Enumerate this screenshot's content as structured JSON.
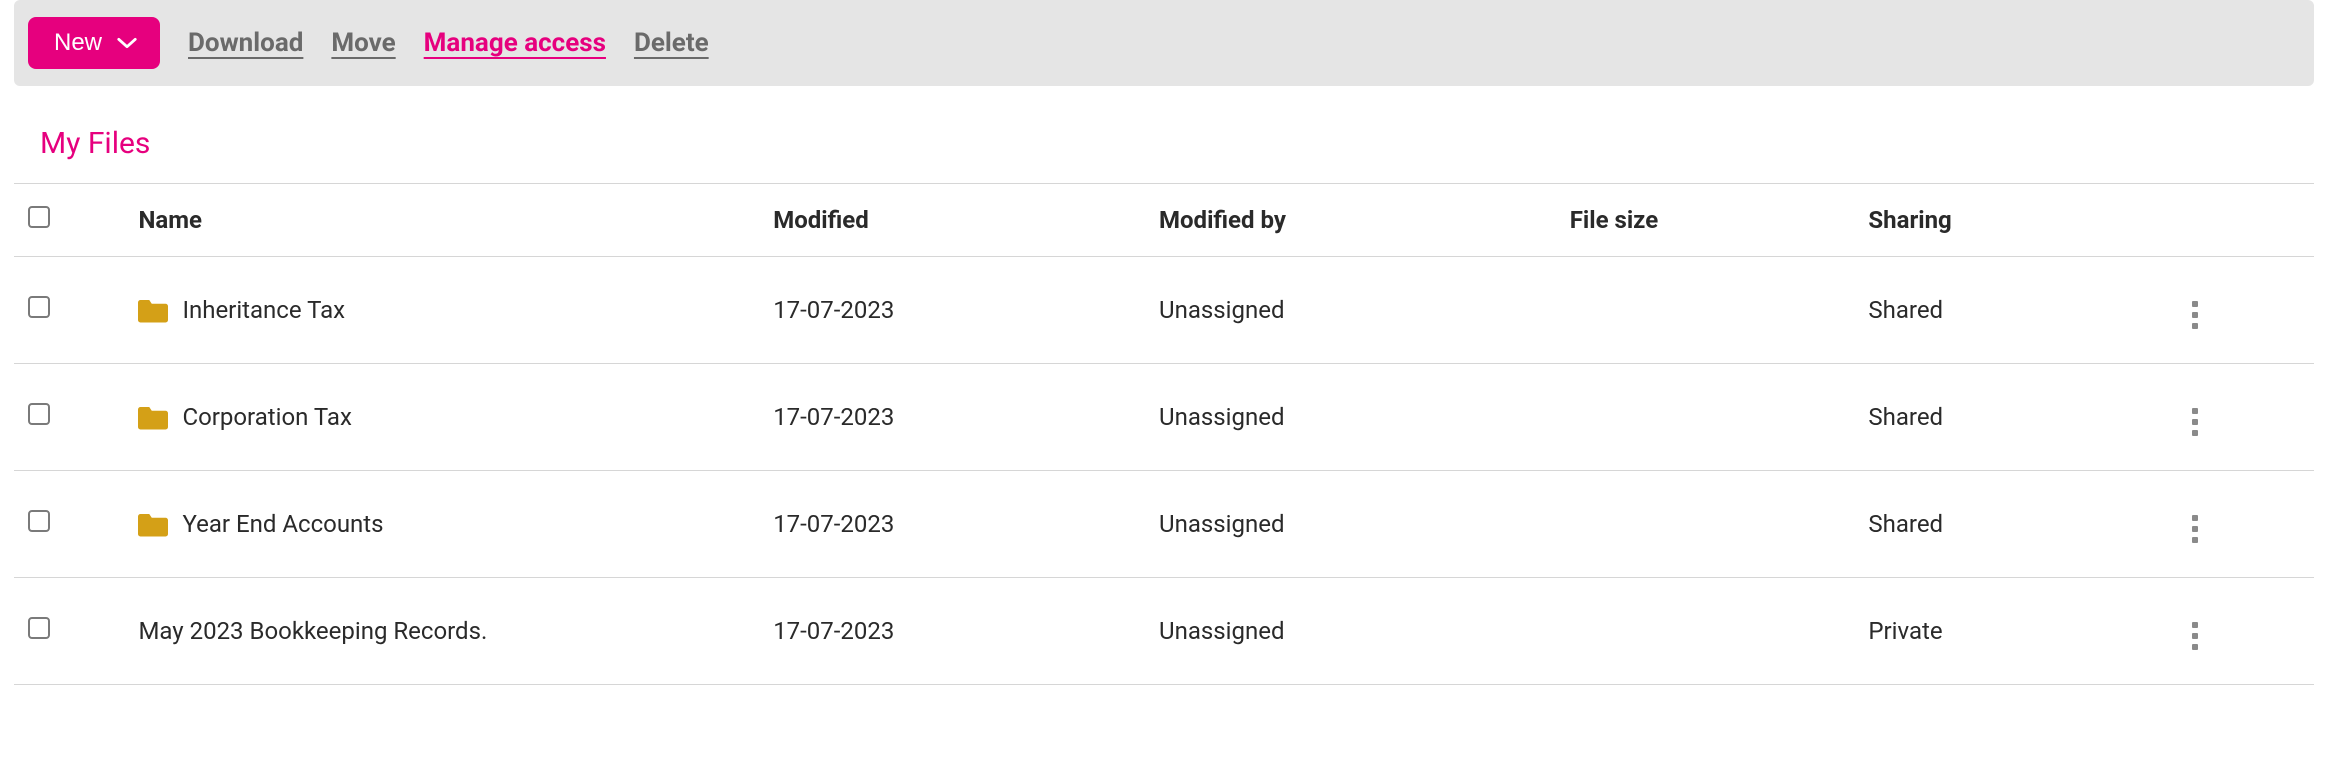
{
  "toolbar": {
    "new_label": "New",
    "download_label": "Download",
    "move_label": "Move",
    "manage_access_label": "Manage access",
    "delete_label": "Delete"
  },
  "page_title": "My Files",
  "columns": {
    "name": "Name",
    "modified": "Modified",
    "modified_by": "Modified by",
    "file_size": "File size",
    "sharing": "Sharing"
  },
  "rows": [
    {
      "name": "Inheritance Tax",
      "is_folder": true,
      "modified": "17-07-2023",
      "modified_by": "Unassigned",
      "file_size": "",
      "sharing": "Shared"
    },
    {
      "name": "Corporation Tax",
      "is_folder": true,
      "modified": "17-07-2023",
      "modified_by": "Unassigned",
      "file_size": "",
      "sharing": "Shared"
    },
    {
      "name": "Year End Accounts",
      "is_folder": true,
      "modified": "17-07-2023",
      "modified_by": "Unassigned",
      "file_size": "",
      "sharing": "Shared"
    },
    {
      "name": "May 2023 Bookkeeping Records.",
      "is_folder": false,
      "modified": "17-07-2023",
      "modified_by": "Unassigned",
      "file_size": "",
      "sharing": "Private"
    }
  ]
}
